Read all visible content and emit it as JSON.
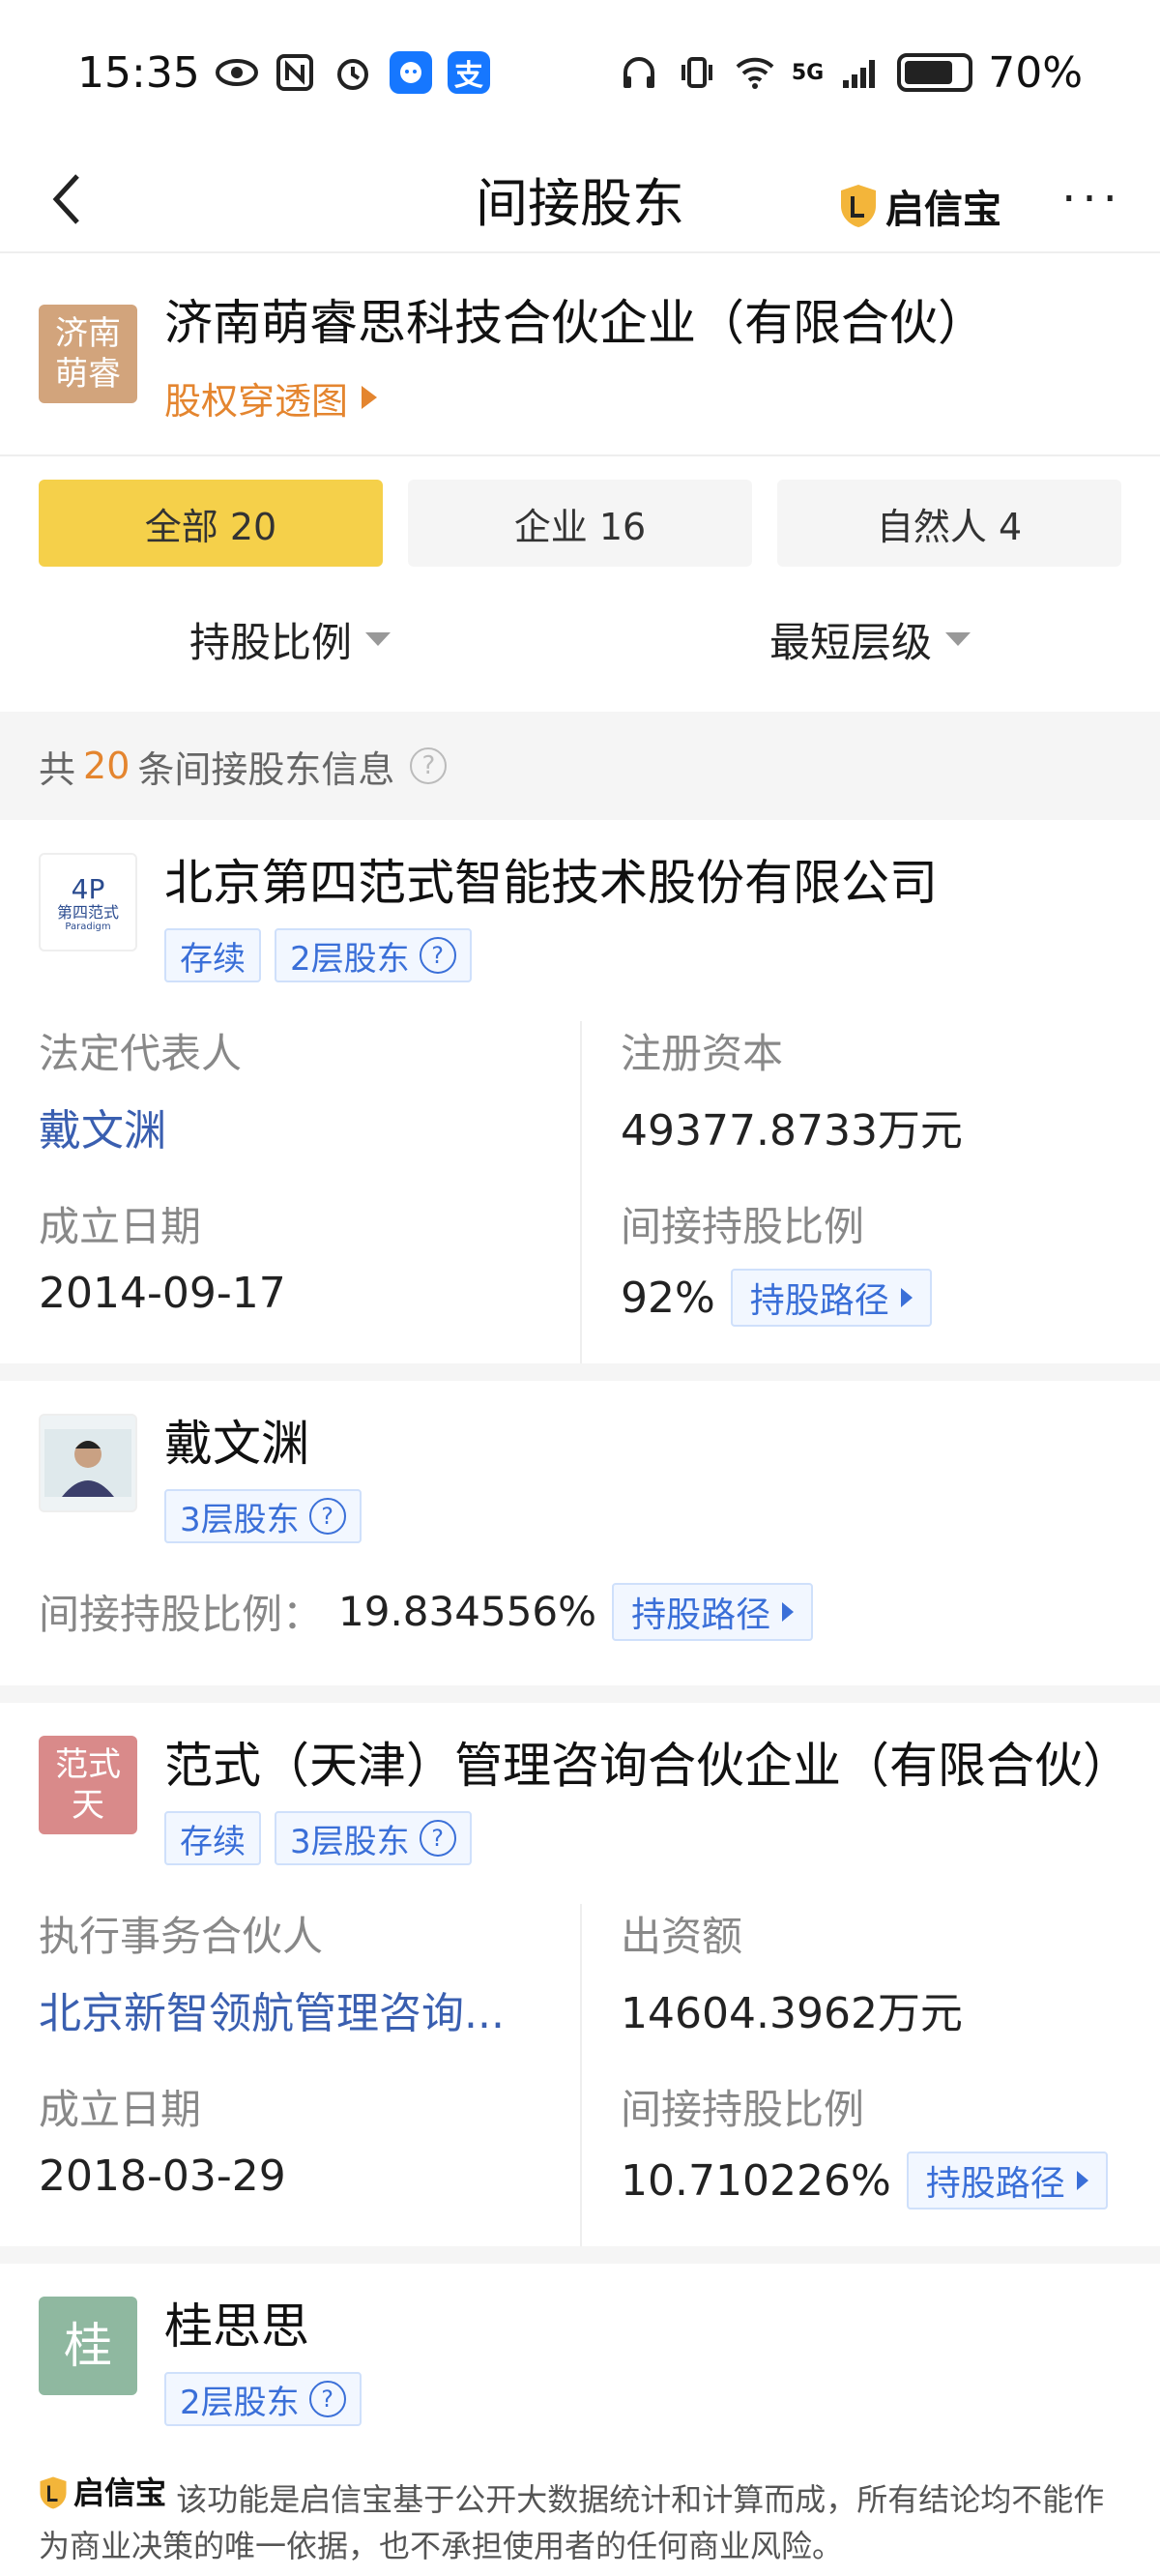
{
  "status_bar": {
    "time": "15:35",
    "battery": "70%",
    "network": "5G",
    "icons": [
      "eye-icon",
      "nfc-icon",
      "alarm-icon",
      "chat-app-icon",
      "alipay-icon",
      "headphones-icon",
      "vibrate-icon",
      "wifi-icon",
      "signal-icon",
      "battery-icon"
    ],
    "alipay_glyph": "支"
  },
  "nav": {
    "title": "间接股东",
    "brand": "启信宝",
    "more": "···"
  },
  "company": {
    "logo_text": "济南萌睿",
    "logo_color": "#d2a47c",
    "name": "济南萌睿思科技合伙企业（有限合伙）",
    "link": "股权穿透图"
  },
  "tabs": [
    {
      "label": "全部 20",
      "active": true
    },
    {
      "label": "企业 16",
      "active": false
    },
    {
      "label": "自然人 4",
      "active": false
    }
  ],
  "filters": {
    "ratio": "持股比例",
    "level": "最短层级"
  },
  "summary": {
    "prefix": "共",
    "count": "20",
    "suffix": "条间接股东信息",
    "help": "?"
  },
  "cards": [
    {
      "name": "北京第四范式智能技术股份有限公司",
      "logo_text": "第四范式",
      "logo_sub": "Paradigm",
      "tags": [
        "存续",
        "2层股东"
      ],
      "fields": [
        {
          "label": "法定代表人",
          "value": "戴文渊"
        },
        {
          "label": "注册资本",
          "value": "49377.8733万元"
        },
        {
          "label": "成立日期",
          "value": "2014-09-17"
        },
        {
          "label": "间接持股比例",
          "value": "92%"
        }
      ],
      "path_label": "持股路径"
    },
    {
      "name": "戴文渊",
      "tags": [
        "3层股东"
      ],
      "ratio_label": "间接持股比例：",
      "ratio_value": "19.834556%",
      "path_label": "持股路径"
    },
    {
      "name": "范式（天津）管理咨询合伙企业（有限合伙）",
      "logo_text": "范式天",
      "logo_color": "#d98a8a",
      "tags": [
        "存续",
        "3层股东"
      ],
      "fields": [
        {
          "label": "执行事务合伙人",
          "value": "北京新智领航管理咨询..."
        },
        {
          "label": "出资额",
          "value": "14604.3962万元"
        },
        {
          "label": "成立日期",
          "value": "2018-03-29"
        },
        {
          "label": "间接持股比例",
          "value": "10.710226%"
        }
      ],
      "path_label": "持股路径"
    },
    {
      "name": "桂思思",
      "logo_text": "桂",
      "logo_color": "#8fb8a0",
      "tags": [
        "2层股东"
      ]
    }
  ],
  "footer": {
    "brand": "启信宝",
    "text": "该功能是启信宝基于公开大数据统计和计算而成，所有结论均不能作为商业决策的唯一依据，也不承担使用者的任何商业风险。"
  }
}
